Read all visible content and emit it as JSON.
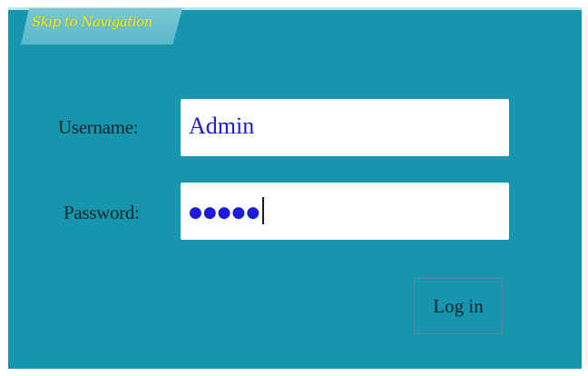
{
  "nav_tab": {
    "label": "Skip to Navigation"
  },
  "form": {
    "username": {
      "label": "Username:",
      "value": "Admin"
    },
    "password": {
      "label": "Password:",
      "masked_value": "●●●●●"
    },
    "login_button": {
      "label": "Log in"
    }
  },
  "colors": {
    "background": "#1596ad",
    "tab_text": "#f5f321",
    "input_text": "#1a1ad8"
  }
}
